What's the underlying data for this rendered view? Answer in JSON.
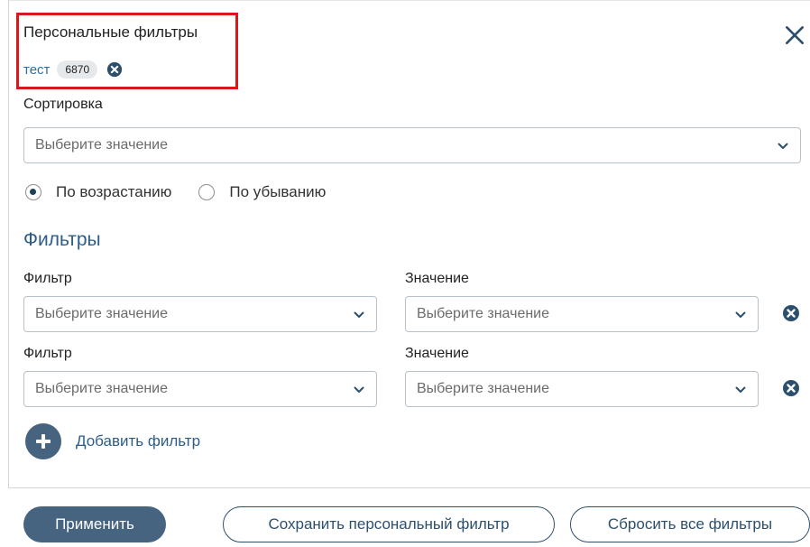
{
  "personal_filters": {
    "title": "Персональные фильтры",
    "chip": {
      "name": "тест",
      "count": "6870"
    }
  },
  "sorting": {
    "label": "Сортировка",
    "select_placeholder": "Выберите значение",
    "options": [
      {
        "label": "По возрастанию",
        "checked": true
      },
      {
        "label": "По убыванию",
        "checked": false
      }
    ]
  },
  "filters": {
    "title": "Фильтры",
    "rows": [
      {
        "filter_label": "Фильтр",
        "filter_placeholder": "Выберите значение",
        "value_label": "Значение",
        "value_placeholder": "Выберите значение"
      },
      {
        "filter_label": "Фильтр",
        "filter_placeholder": "Выберите значение",
        "value_label": "Значение",
        "value_placeholder": "Выберите значение"
      }
    ],
    "add_label": "Добавить фильтр"
  },
  "footer": {
    "apply_label": "Применить",
    "save_label": "Сохранить персональный фильтр",
    "reset_label": "Сбросить все фильтры"
  },
  "colors": {
    "accent": "#46637f",
    "link": "#2d6ea8",
    "highlight": "#d7191c"
  },
  "icons": {
    "close": "close-icon",
    "chip_remove": "times-circle-icon",
    "chevron": "chevron-down-icon",
    "add": "plus-circle-icon"
  }
}
